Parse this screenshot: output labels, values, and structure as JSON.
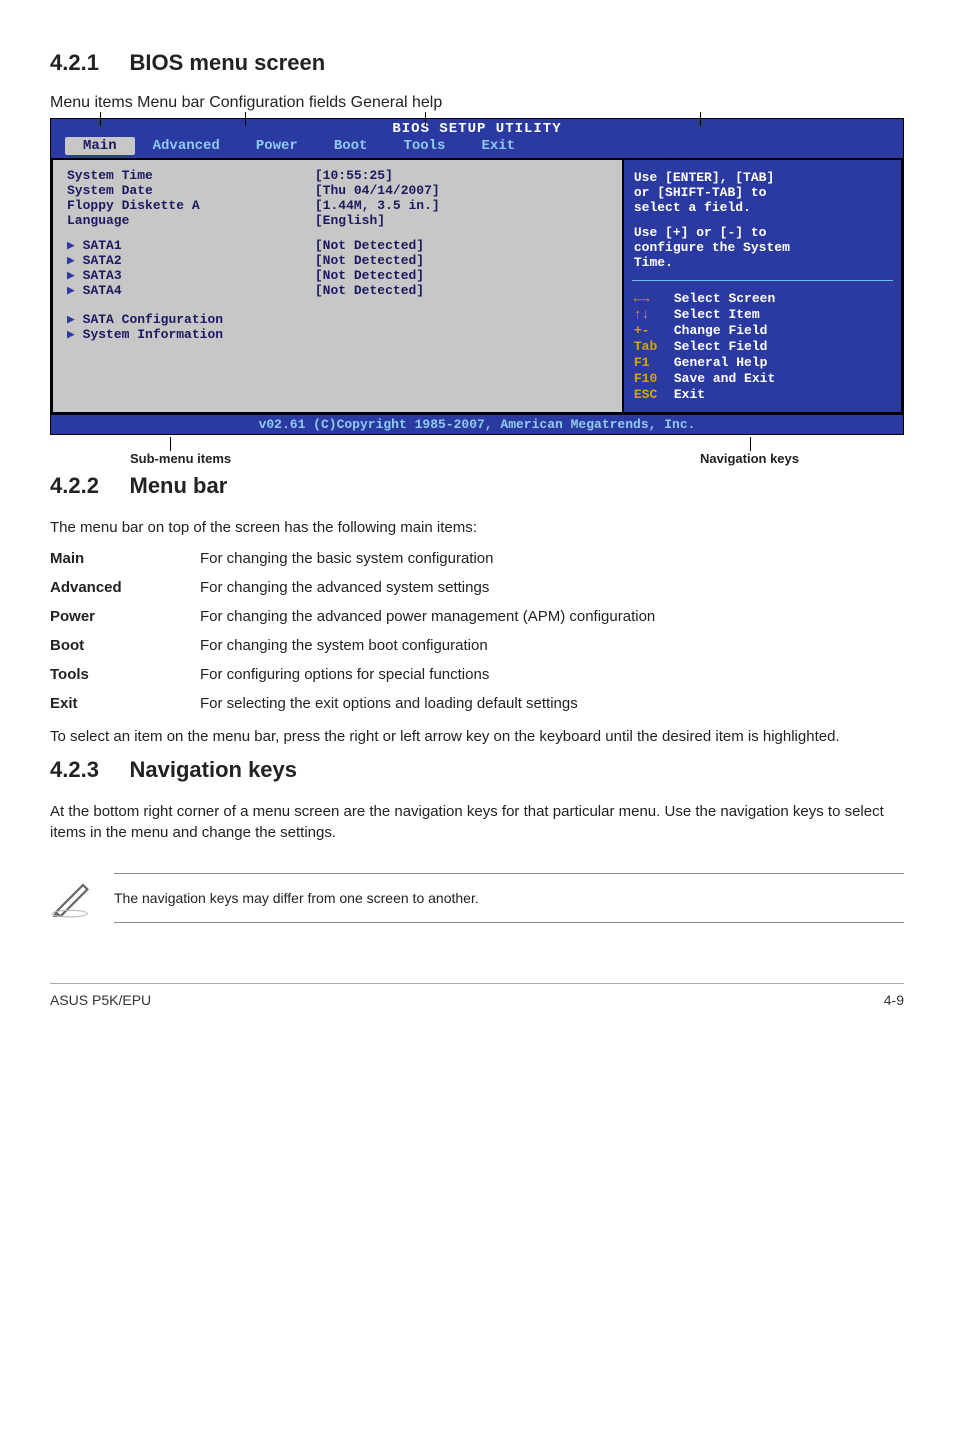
{
  "section1": {
    "num": "4.2.1",
    "title": "BIOS menu screen"
  },
  "topLabels": {
    "menuItems": "Menu items",
    "menuBar": "Menu bar",
    "configFields": "Configuration fields",
    "generalHelp": "General help"
  },
  "bios": {
    "title": "BIOS SETUP UTILITY",
    "menu": {
      "main": "Main",
      "advanced": "Advanced",
      "power": "Power",
      "boot": "Boot",
      "tools": "Tools",
      "exit": "Exit"
    },
    "left": {
      "sysTime": "System Time",
      "sysDate": "System Date",
      "floppy": "Floppy Diskette A",
      "language": "Language",
      "sata1": "SATA1",
      "sata2": "SATA2",
      "sata3": "SATA3",
      "sata4": "SATA4",
      "sataCfg": "SATA Configuration",
      "sysInfo": "System Information"
    },
    "mid": {
      "time": "[10:55:25]",
      "date": "[Thu 04/14/2007]",
      "floppy": "[1.44M, 3.5 in.]",
      "language": "[English]",
      "nd1": "[Not Detected]",
      "nd2": "[Not Detected]",
      "nd3": "[Not Detected]",
      "nd4": "[Not Detected]"
    },
    "help": {
      "line1": "Use [ENTER], [TAB]",
      "line2": "or [SHIFT-TAB] to",
      "line3": "select a field.",
      "line4": "Use [+] or [-] to",
      "line5": "configure the System",
      "line6": "Time.",
      "k1l": "←→",
      "k1": "Select Screen",
      "k2l": "↑↓",
      "k2": "Select Item",
      "k3l": "+-",
      "k3": "Change Field",
      "k4l": "Tab",
      "k4": "Select Field",
      "k5l": "F1",
      "k5": "General Help",
      "k6l": "F10",
      "k6": "Save and Exit",
      "k7l": "ESC",
      "k7": "Exit"
    },
    "footer": "v02.61 (C)Copyright 1985-2007, American Megatrends, Inc."
  },
  "bottomLabels": {
    "submenu": "Sub-menu items",
    "navkeys": "Navigation keys"
  },
  "section2": {
    "num": "4.2.2",
    "title": "Menu bar"
  },
  "p1": "The menu bar on top of the screen has the following main items:",
  "defs": {
    "main_t": "Main",
    "main_d": "For changing the basic system configuration",
    "adv_t": "Advanced",
    "adv_d": "For changing the advanced system settings",
    "pow_t": "Power",
    "pow_d": "For changing the advanced power management (APM) configuration",
    "boot_t": "Boot",
    "boot_d": "For changing the system boot configuration",
    "tools_t": "Tools",
    "tools_d": "For configuring options for special functions",
    "exit_t": "Exit",
    "exit_d": "For selecting the exit options and loading default settings"
  },
  "p2": "To select an item on the menu bar, press the right or left arrow key on the keyboard until the desired item is highlighted.",
  "section3": {
    "num": "4.2.3",
    "title": "Navigation keys"
  },
  "p3": "At the bottom right corner of a menu screen are the navigation keys for that particular menu. Use the navigation keys to select items in the menu and change the settings.",
  "note": "The navigation keys may differ from one screen to another.",
  "footer": {
    "left": "ASUS P5K/EPU",
    "right": "4-9"
  }
}
